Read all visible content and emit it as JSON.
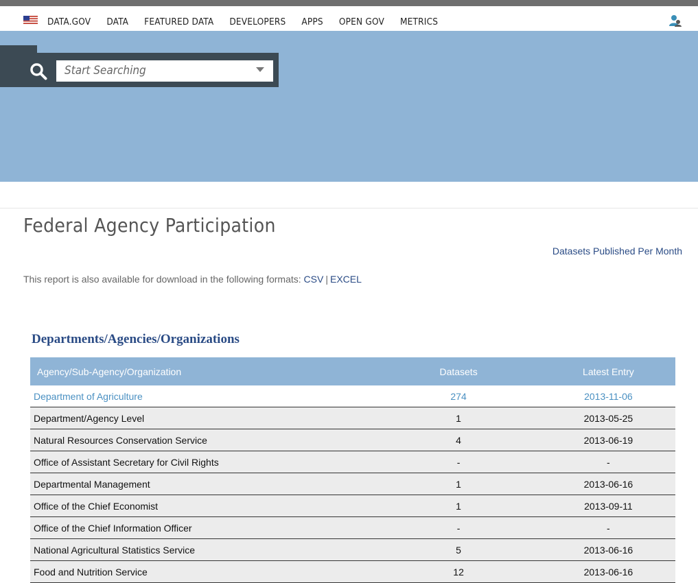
{
  "nav": {
    "items": [
      "DATA.GOV",
      "DATA",
      "FEATURED DATA",
      "DEVELOPERS",
      "APPS",
      "OPEN GOV",
      "METRICS"
    ]
  },
  "search": {
    "placeholder": "Start Searching"
  },
  "page": {
    "title": "Federal Agency Participation",
    "side_link": "Datasets Published Per Month",
    "download_text": "This report is also available for download in the following formats:",
    "csv_label": "CSV",
    "separator": "|",
    "excel_label": "EXCEL"
  },
  "section": {
    "title": "Departments/Agencies/Organizations"
  },
  "table": {
    "headers": [
      "Agency/Sub-Agency/Organization",
      "Datasets",
      "Latest Entry"
    ],
    "rows": [
      {
        "name": "Department of Agriculture",
        "datasets": "274",
        "latest": "2013-11-06"
      },
      {
        "name": "Department/Agency Level",
        "datasets": "1",
        "latest": "2013-05-25"
      },
      {
        "name": "Natural Resources Conservation Service",
        "datasets": "4",
        "latest": "2013-06-19"
      },
      {
        "name": "Office of Assistant Secretary for Civil Rights",
        "datasets": "-",
        "latest": "-"
      },
      {
        "name": "Departmental Management",
        "datasets": "1",
        "latest": "2013-06-16"
      },
      {
        "name": "Office of the Chief Economist",
        "datasets": "1",
        "latest": "2013-09-11"
      },
      {
        "name": "Office of the Chief Information Officer",
        "datasets": "-",
        "latest": "-"
      },
      {
        "name": "National Agricultural Statistics Service",
        "datasets": "5",
        "latest": "2013-06-16"
      },
      {
        "name": "Food and Nutrition Service",
        "datasets": "12",
        "latest": "2013-06-16"
      }
    ]
  },
  "colors": {
    "hero": "#8fb4d6",
    "search_panel": "#3c4a54",
    "link": "#2a4b85",
    "dept_link": "#4a90c2"
  },
  "icons": [
    "us-flag-icon",
    "search-icon",
    "chevron-down-icon",
    "user-icon"
  ]
}
